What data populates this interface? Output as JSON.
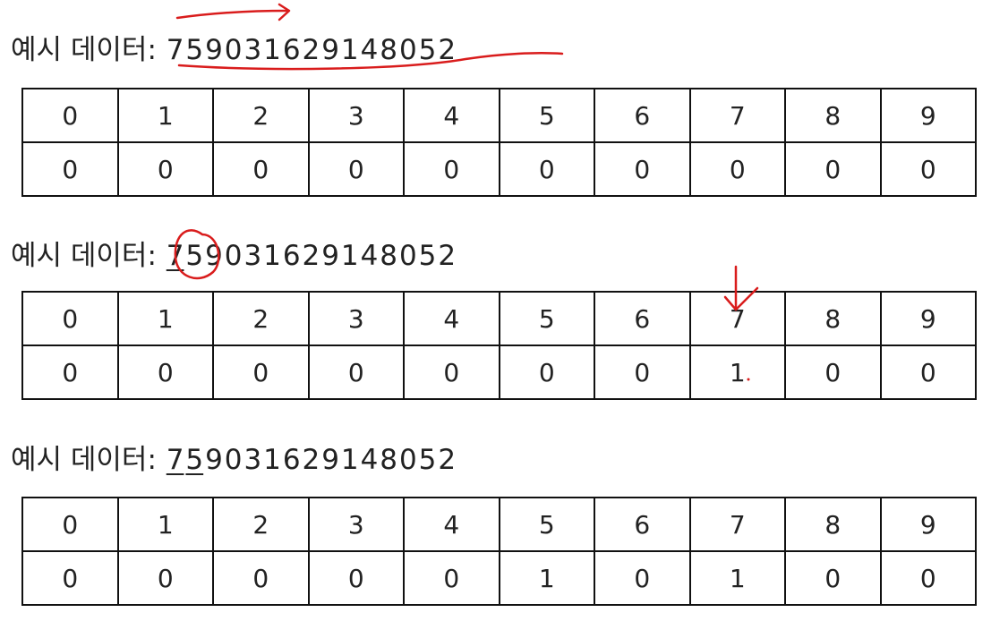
{
  "sections": [
    {
      "line": {
        "prefix": "예시 데이터:",
        "digits": [
          "7",
          "5",
          "9",
          "0",
          "3",
          "1",
          "6",
          "2",
          "9",
          "1",
          "4",
          "8",
          "0",
          "5",
          "2"
        ],
        "underlined": []
      },
      "table": {
        "indices": [
          "0",
          "1",
          "2",
          "3",
          "4",
          "5",
          "6",
          "7",
          "8",
          "9"
        ],
        "counts": [
          "0",
          "0",
          "0",
          "0",
          "0",
          "0",
          "0",
          "0",
          "0",
          "0"
        ]
      }
    },
    {
      "line": {
        "prefix": "예시 데이터:",
        "digits": [
          "7",
          "5",
          "9",
          "0",
          "3",
          "1",
          "6",
          "2",
          "9",
          "1",
          "4",
          "8",
          "0",
          "5",
          "2"
        ],
        "underlined": [
          0
        ]
      },
      "table": {
        "indices": [
          "0",
          "1",
          "2",
          "3",
          "4",
          "5",
          "6",
          "7",
          "8",
          "9"
        ],
        "counts": [
          "0",
          "0",
          "0",
          "0",
          "0",
          "0",
          "0",
          "1",
          "0",
          "0"
        ]
      }
    },
    {
      "line": {
        "prefix": "예시 데이터:",
        "digits": [
          "7",
          "5",
          "9",
          "0",
          "3",
          "1",
          "6",
          "2",
          "9",
          "1",
          "4",
          "8",
          "0",
          "5",
          "2"
        ],
        "underlined": [
          0,
          1
        ]
      },
      "table": {
        "indices": [
          "0",
          "1",
          "2",
          "3",
          "4",
          "5",
          "6",
          "7",
          "8",
          "9"
        ],
        "counts": [
          "0",
          "0",
          "0",
          "0",
          "0",
          "1",
          "0",
          "1",
          "0",
          "0"
        ]
      }
    }
  ],
  "annotation_color": "#d91c1c"
}
